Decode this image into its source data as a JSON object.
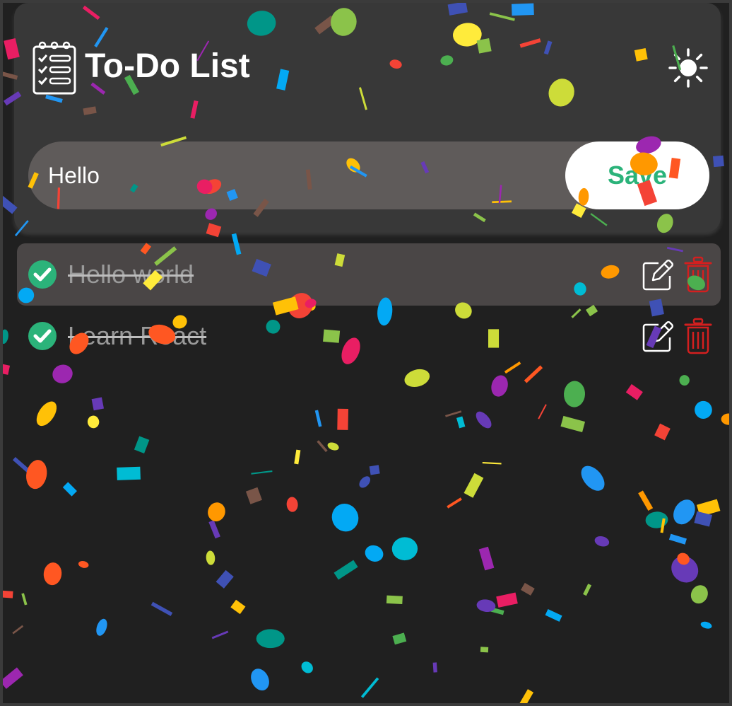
{
  "app": {
    "title": "To-Do List",
    "icons": {
      "app": "checklist-clipboard-icon",
      "theme": "sun-icon"
    }
  },
  "input": {
    "value": "Hello",
    "save_label": "Save"
  },
  "todos": [
    {
      "text": "Hello world",
      "completed": true
    },
    {
      "text": "Learn React",
      "completed": true
    }
  ],
  "colors": {
    "background": "#202020",
    "card": "#383838",
    "input_bg": "#5f5b5a",
    "accent": "#2bb37a",
    "delete": "#d41f1f",
    "completed_text": "#9a9a9a"
  }
}
